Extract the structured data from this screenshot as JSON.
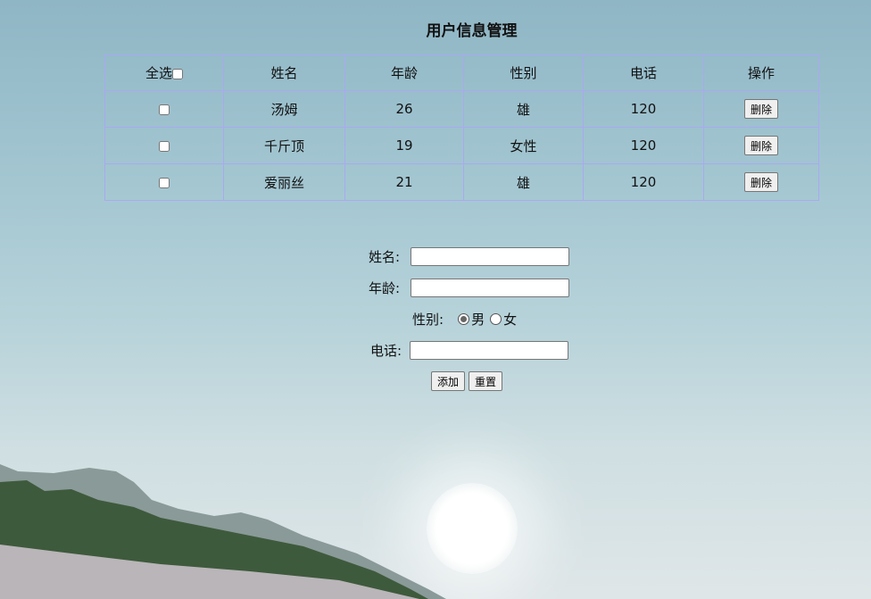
{
  "page": {
    "title": "用户信息管理"
  },
  "table": {
    "headers": {
      "select_all": "全选",
      "name": "姓名",
      "age": "年龄",
      "gender": "性别",
      "phone": "电话",
      "actions": "操作"
    },
    "rows": [
      {
        "name": "汤姆",
        "age": "26",
        "gender": "雄",
        "phone": "120",
        "delete": "删除"
      },
      {
        "name": "千斤顶",
        "age": "19",
        "gender": "女性",
        "phone": "120",
        "delete": "删除"
      },
      {
        "name": "爱丽丝",
        "age": "21",
        "gender": "雄",
        "phone": "120",
        "delete": "删除"
      }
    ]
  },
  "form": {
    "name_label": "姓名:",
    "name_value": "",
    "age_label": "年龄:",
    "age_value": "",
    "gender_label": "性别:",
    "gender_male": "男",
    "gender_female": "女",
    "gender_selected": "男",
    "phone_label": "电话:",
    "phone_value": "",
    "add_label": "添加",
    "reset_label": "重置"
  }
}
